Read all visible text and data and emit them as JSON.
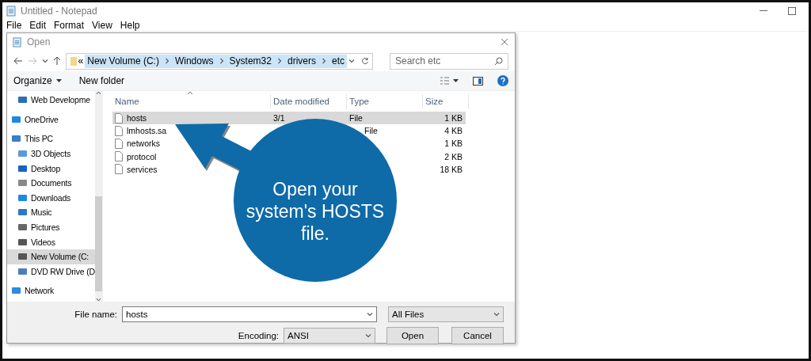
{
  "notepad": {
    "title": "Untitled - Notepad",
    "menu": [
      "File",
      "Edit",
      "Format",
      "View",
      "Help"
    ]
  },
  "dialog": {
    "title": "Open",
    "address": {
      "overflow": "«",
      "selected": true,
      "crumbs": [
        "New Volume (C:)",
        "Windows",
        "System32",
        "drivers",
        "etc"
      ]
    },
    "search": {
      "placeholder": "Search etc"
    },
    "toolbar": {
      "organize": "Organize",
      "new_folder": "New folder"
    },
    "nav_pane": [
      {
        "children": [
          {
            "label": "Web Developme",
            "selected": false
          }
        ]
      },
      {
        "label": "OneDrive",
        "selected": false
      },
      {
        "label": "This PC",
        "selected": false,
        "children": [
          {
            "label": "3D Objects",
            "selected": false
          },
          {
            "label": "Desktop",
            "selected": false
          },
          {
            "label": "Documents",
            "selected": false
          },
          {
            "label": "Downloads",
            "selected": false
          },
          {
            "label": "Music",
            "selected": false
          },
          {
            "label": "Pictures",
            "selected": false
          },
          {
            "label": "Videos",
            "selected": false
          },
          {
            "label": "New Volume (C:",
            "selected": true
          },
          {
            "label": "DVD RW Drive (D",
            "selected": false
          }
        ]
      },
      {
        "label": "Network",
        "selected": false
      }
    ],
    "columns": [
      "Name",
      "Date modified",
      "Type",
      "Size"
    ],
    "files": [
      {
        "name": "hosts",
        "date": "3/1",
        "type": "File",
        "size": "1 KB",
        "selected": true
      },
      {
        "name": "lmhosts.sa",
        "type": "File",
        "size": "4 KB",
        "selected": false
      },
      {
        "name": "networks",
        "size": "1 KB",
        "selected": false
      },
      {
        "name": "protocol",
        "size": "2 KB",
        "selected": false
      },
      {
        "name": "services",
        "size": "18 KB",
        "selected": false
      }
    ],
    "file_name": {
      "label": "File name:",
      "value": "hosts"
    },
    "filter": "All Files",
    "encoding": {
      "label": "Encoding:",
      "value": "ANSI"
    },
    "buttons": [
      "Open",
      "Cancel"
    ]
  },
  "callout": {
    "text": "Open your system's HOSTS file."
  }
}
